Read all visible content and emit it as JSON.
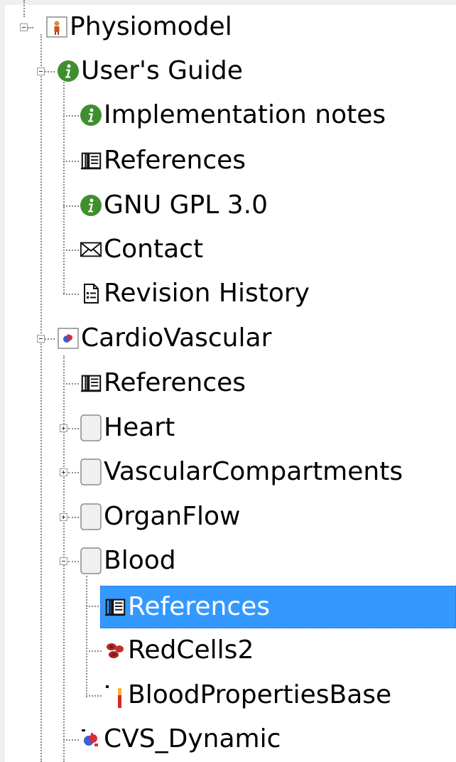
{
  "tree": {
    "items": [
      {
        "label": "Physiomodel",
        "icon": "person-model-icon"
      },
      {
        "label": "User's Guide",
        "icon": "info-icon"
      },
      {
        "label": "Implementation notes",
        "icon": "info-icon"
      },
      {
        "label": "References",
        "icon": "book-icon"
      },
      {
        "label": "GNU GPL 3.0",
        "icon": "info-icon"
      },
      {
        "label": "Contact",
        "icon": "envelope-icon"
      },
      {
        "label": "Revision History",
        "icon": "document-icon"
      },
      {
        "label": "CardioVascular",
        "icon": "heart-package-icon"
      },
      {
        "label": "References",
        "icon": "book-icon"
      },
      {
        "label": "Heart",
        "icon": "package-icon"
      },
      {
        "label": "VascularCompartments",
        "icon": "package-icon"
      },
      {
        "label": "OrganFlow",
        "icon": "package-icon"
      },
      {
        "label": "Blood",
        "icon": "package-icon"
      },
      {
        "label": "References",
        "icon": "book-icon",
        "selected": true
      },
      {
        "label": "RedCells2",
        "icon": "red-cells-icon"
      },
      {
        "label": "BloodPropertiesBase",
        "icon": "blood-properties-icon"
      },
      {
        "label": "CVS_Dynamic",
        "icon": "heart-model-icon"
      }
    ]
  },
  "colors": {
    "selection": "#3399ff",
    "info_green": "#3f8f2f",
    "tree_lines": "#8a8a8a"
  }
}
